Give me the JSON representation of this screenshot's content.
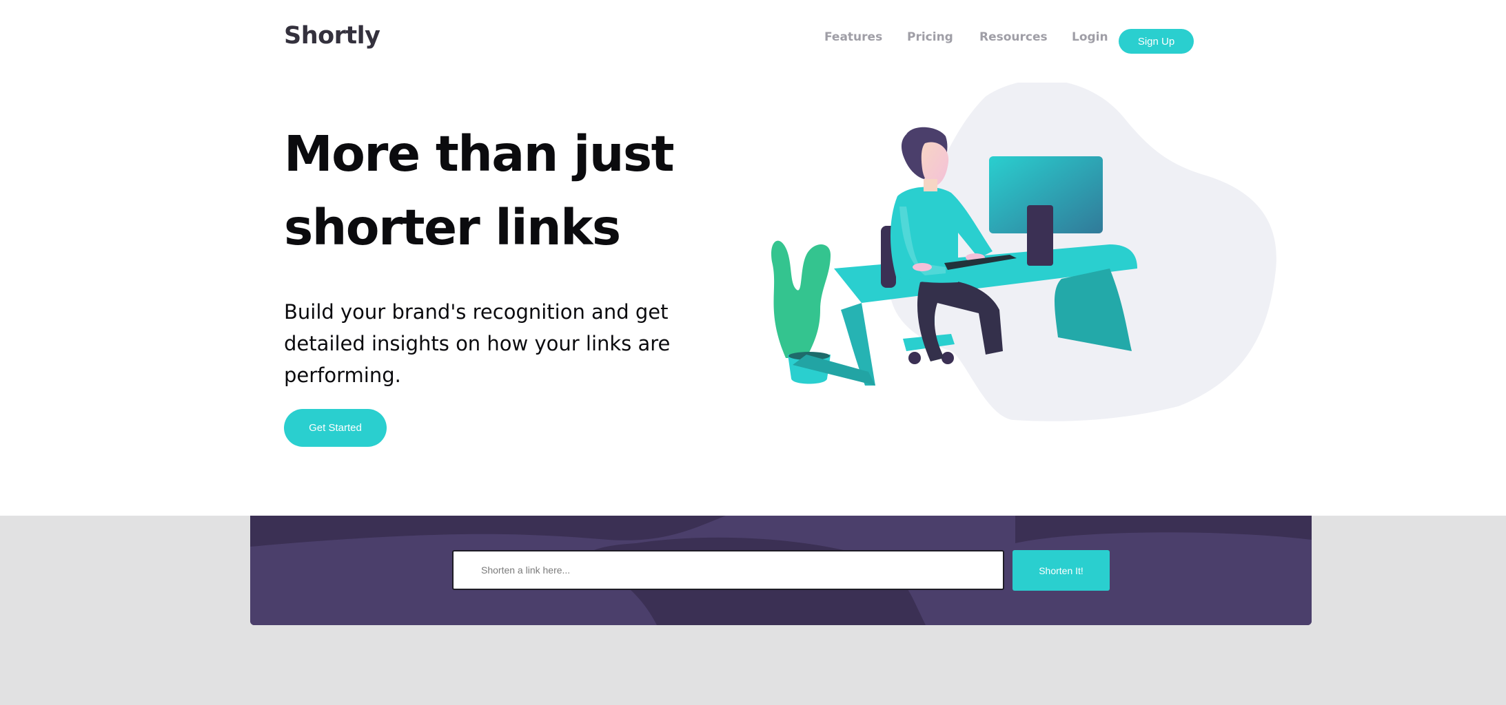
{
  "brand": {
    "logo": "Shortly",
    "accent_color": "#2acfcf",
    "dark_violet": "#4b3f6b"
  },
  "nav": {
    "items": [
      {
        "label": "Features"
      },
      {
        "label": "Pricing"
      },
      {
        "label": "Resources"
      }
    ],
    "login_label": "Login",
    "signup_label": "Sign Up"
  },
  "hero": {
    "title": "More than just shorter links",
    "subtitle": "Build your brand's recognition and get detailed insights on how your links are performing.",
    "cta_label": "Get Started",
    "illustration_icon": "person-working-illustration"
  },
  "shorten": {
    "placeholder": "Shorten a link here...",
    "value": "",
    "button_label": "Shorten It!"
  }
}
